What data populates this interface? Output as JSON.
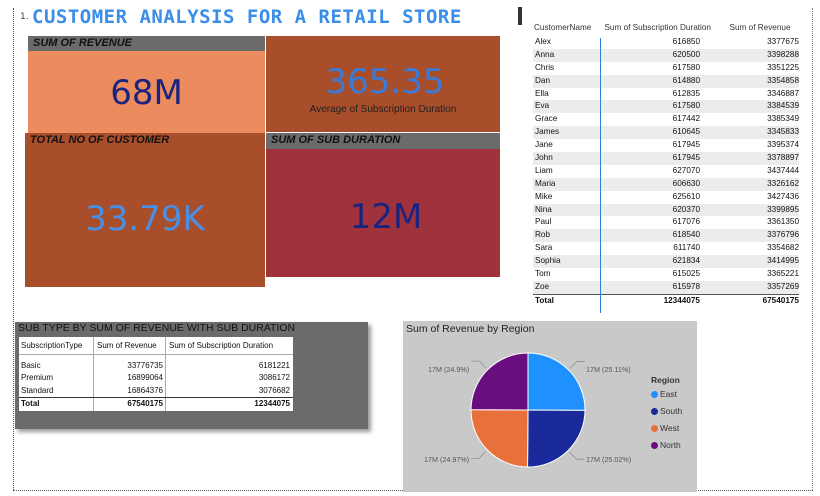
{
  "page": {
    "title_number": "1.",
    "title": "CUSTOMER ANALYSIS FOR A RETAIL STORE"
  },
  "kpis": {
    "revenue": {
      "header": "SUM OF REVENUE",
      "value": "68M"
    },
    "avg_sub": {
      "value": "365.35",
      "caption": "Average of Subscription Duration"
    },
    "customers": {
      "header": "TOTAL NO OF CUSTOMER",
      "value": "33.79K"
    },
    "sub_duration": {
      "header": "SUM OF SUB DURATION",
      "value": "12M"
    }
  },
  "customer_table": {
    "headers": [
      "CustomerName",
      "Sum of Subscription Duration",
      "Sum of Revenue"
    ],
    "rows": [
      [
        "Alex",
        "616850",
        "3377675"
      ],
      [
        "Anna",
        "620500",
        "3398288"
      ],
      [
        "Chris",
        "617580",
        "3351225"
      ],
      [
        "Dan",
        "614880",
        "3354858"
      ],
      [
        "Ella",
        "612835",
        "3346887"
      ],
      [
        "Eva",
        "617580",
        "3384539"
      ],
      [
        "Grace",
        "617442",
        "3385349"
      ],
      [
        "James",
        "610645",
        "3345833"
      ],
      [
        "Jane",
        "617945",
        "3395374"
      ],
      [
        "John",
        "617945",
        "3378897"
      ],
      [
        "Liam",
        "627070",
        "3437444"
      ],
      [
        "Maria",
        "606630",
        "3326162"
      ],
      [
        "Mike",
        "625610",
        "3427436"
      ],
      [
        "Nina",
        "620370",
        "3399895"
      ],
      [
        "Paul",
        "617076",
        "3361350"
      ],
      [
        "Rob",
        "618540",
        "3376796"
      ],
      [
        "Sara",
        "611740",
        "3354682"
      ],
      [
        "Sophia",
        "621834",
        "3414995"
      ],
      [
        "Tom",
        "615025",
        "3365221"
      ],
      [
        "Zoe",
        "615978",
        "3357269"
      ]
    ],
    "total": [
      "Total",
      "12344075",
      "67540175"
    ]
  },
  "subtype_table": {
    "title": "SUB TYPE BY SUM OF REVENUE WITH SUB DURATION",
    "headers": [
      "SubscriptionType",
      "Sum of Revenue",
      "Sum of Subscription Duration"
    ],
    "rows": [
      [
        "Basic",
        "33776735",
        "6181221"
      ],
      [
        "Premium",
        "16899064",
        "3086172"
      ],
      [
        "Standard",
        "16864376",
        "3076682"
      ]
    ],
    "total": [
      "Total",
      "67540175",
      "12344075"
    ]
  },
  "pie": {
    "title": "Sum of Revenue by Region",
    "legend_title": "Region",
    "labels": {
      "east": "17M (25.11%)",
      "south": "17M (25.02%)",
      "west": "17M (24.97%)",
      "north": "17M (24.9%)"
    }
  },
  "colors": {
    "title_blue": "#3b8ee8",
    "revenue_bg": "#ec8c5e",
    "avg_bg": "#a84e2a",
    "customers_bg": "#a84e2a",
    "subdur_bg": "#a0323c",
    "east": "#1e90ff",
    "south": "#1a2a9a",
    "west": "#e8703a",
    "north": "#6a0d7e"
  },
  "chart_data": {
    "type": "pie",
    "title": "Sum of Revenue by Region",
    "legend_title": "Region",
    "categories": [
      "East",
      "South",
      "West",
      "North"
    ],
    "values": [
      25.11,
      25.02,
      24.97,
      24.9
    ],
    "unit": "%",
    "display_labels": [
      "17M (25.11%)",
      "17M (25.02%)",
      "17M (24.97%)",
      "17M (24.9%)"
    ]
  }
}
